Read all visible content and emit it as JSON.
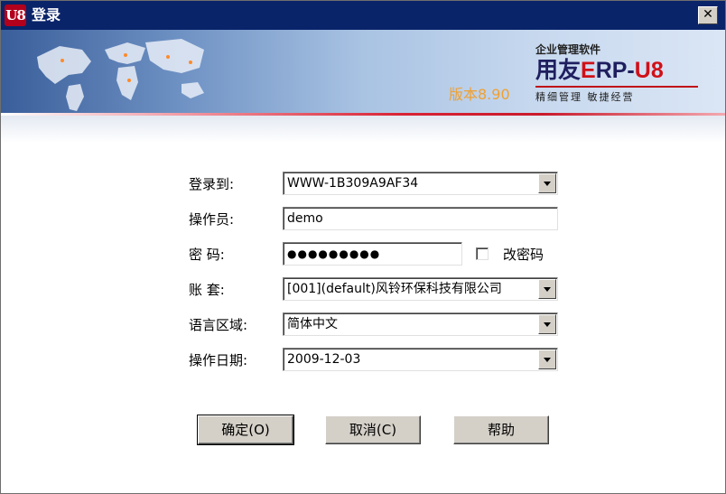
{
  "window": {
    "title": "登录",
    "app_icon_text": "U8",
    "close_label": "✕"
  },
  "banner": {
    "tagline": "企业管理软件",
    "logo_prefix": "用友",
    "logo_e": "E",
    "logo_rp": "RP-",
    "logo_u8": "U8",
    "slogan": "精细管理   敏捷经营",
    "version": "版本8.90"
  },
  "form": {
    "server_label": "登录到:",
    "server_value": "WWW-1B309A9AF34",
    "operator_label": "操作员:",
    "operator_value": "demo",
    "password_label": "密  码:",
    "password_value": "●●●●●●●●●",
    "change_password_label": "改密码",
    "change_password_checked": false,
    "account_label": "账  套:",
    "account_value": "[001](default)风铃环保科技有限公司",
    "language_label": "语言区域:",
    "language_value": "简体中文",
    "date_label": "操作日期:",
    "date_value": "2009-12-03"
  },
  "buttons": {
    "ok": "确定(O)",
    "cancel": "取消(C)",
    "help": "帮助"
  },
  "colors": {
    "titlebar": "#0a246a",
    "brand_red": "#d01018",
    "version_orange": "#f0a030"
  }
}
